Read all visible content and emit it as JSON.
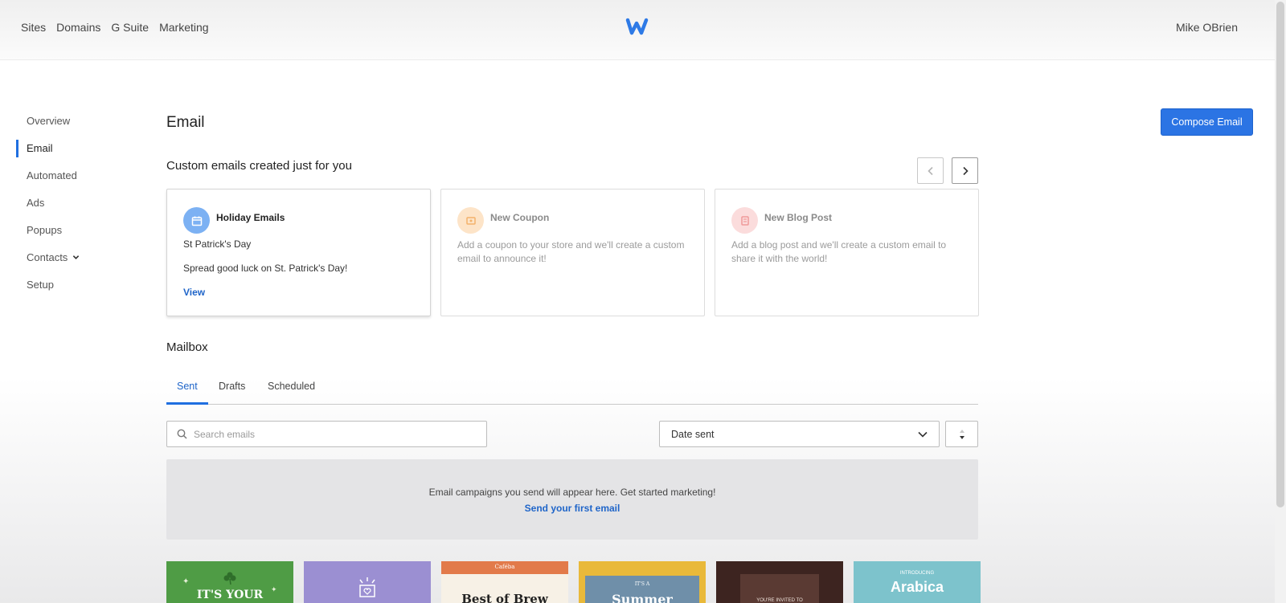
{
  "topnav": {
    "items": [
      "Sites",
      "Domains",
      "G Suite",
      "Marketing"
    ],
    "user": "Mike OBrien"
  },
  "sidebar": {
    "items": [
      {
        "label": "Overview"
      },
      {
        "label": "Email",
        "active": true
      },
      {
        "label": "Automated"
      },
      {
        "label": "Ads"
      },
      {
        "label": "Popups"
      },
      {
        "label": "Contacts",
        "has_dropdown": true
      },
      {
        "label": "Setup"
      }
    ]
  },
  "main": {
    "title": "Email",
    "compose_label": "Compose Email",
    "custom_section_title": "Custom emails created just for you",
    "cards": [
      {
        "title": "Holiday Emails",
        "subtitle": "St Patrick's Day",
        "description": "Spread good luck on St. Patrick's Day!",
        "link": "View",
        "icon": "calendar-icon"
      },
      {
        "title": "New Coupon",
        "description": "Add a coupon to your store and we'll create a custom email to announce it!",
        "icon": "coupon-icon"
      },
      {
        "title": "New Blog Post",
        "description": "Add a blog post and we'll create a custom email to share it with the world!",
        "icon": "blog-post-icon"
      }
    ],
    "mailbox": {
      "title": "Mailbox",
      "tabs": [
        "Sent",
        "Drafts",
        "Scheduled"
      ],
      "active_tab": "Sent",
      "search_placeholder": "Search emails",
      "sort_select_value": "Date sent",
      "empty_text": "Email campaigns you send will appear here. Get started marketing!",
      "empty_link": "Send your first email"
    },
    "templates": [
      {
        "text": "IT'S YOUR"
      },
      {
        "text": ""
      },
      {
        "text": "Best of Brew",
        "top": "Caféba"
      },
      {
        "text": "Summer",
        "top": "IT'S A"
      },
      {
        "text": "YOU'RE INVITED TO"
      },
      {
        "text": "Arabica",
        "top": "INTRODUCING"
      }
    ]
  },
  "colors": {
    "accent": "#2b74e4",
    "link": "#1f65c9",
    "active_indicator": "#1f6fe0"
  }
}
